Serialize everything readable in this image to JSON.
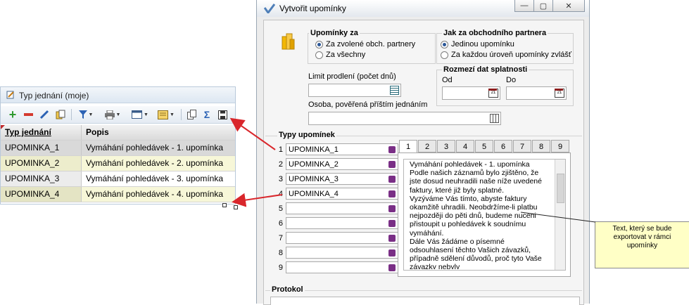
{
  "left_window": {
    "title": "Typ jednání (moje)",
    "columns": [
      "Typ jednání",
      "Popis"
    ],
    "rows": [
      {
        "code": "UPOMINKA_1",
        "desc": "Vymáhání pohledávek - 1. upomínka"
      },
      {
        "code": "UPOMINKA_2",
        "desc": "Vymáhání pohledávek - 2. upomínka"
      },
      {
        "code": "UPOMINKA_3",
        "desc": "Vymáhání pohledávek - 3. upomínka"
      },
      {
        "code": "UPOMINKA_4",
        "desc": "Vymáhání pohledávek - 4. upomínka"
      }
    ]
  },
  "dialog": {
    "title": "Vytvořit upomínky",
    "upominky_za": {
      "label": "Upomínky za",
      "options": [
        "Za zvolené obch. partnery",
        "Za všechny"
      ],
      "selected": 0
    },
    "jak_za": {
      "label": "Jak za obchodního partnera",
      "options": [
        "Jedinou upomínku",
        "Za každou úroveň upomínky zvlášť"
      ],
      "selected": 0
    },
    "limit_label": "Limit prodlení (počet dnů)",
    "rozmezi": {
      "label": "Rozmezí dat splatnosti",
      "od": "Od",
      "do": "Do"
    },
    "osoba_label": "Osoba, pověřená příštím jednáním",
    "typy_label": "Typy upomínek",
    "typy": [
      {
        "num": "1",
        "value": "UPOMINKA_1"
      },
      {
        "num": "2",
        "value": "UPOMINKA_2"
      },
      {
        "num": "3",
        "value": "UPOMINKA_3"
      },
      {
        "num": "4",
        "value": "UPOMINKA_4"
      },
      {
        "num": "5",
        "value": ""
      },
      {
        "num": "6",
        "value": ""
      },
      {
        "num": "7",
        "value": ""
      },
      {
        "num": "8",
        "value": ""
      },
      {
        "num": "9",
        "value": ""
      }
    ],
    "tabs": [
      "1",
      "2",
      "3",
      "4",
      "5",
      "6",
      "7",
      "8",
      "9"
    ],
    "active_tab": 0,
    "memo": "Vymáhání pohledávek - 1. upomínka\nPodle našich záznamů bylo zjištěno, že jste dosud neuhradili naše níže uvedené faktury, které již byly splatné.\nVyzýváme Vás tímto, abyste faktury okamžitě uhradili. Neobdržíme-li platbu nejpozději do pěti dnů, budeme nuceni přistoupit u pohledávek k soudnímu vymáhání.\nDále Vás žádáme o písemné odsouhlasení těchto Vašich závazků, případně sdělení důvodů, proč tyto Vaše závazky nebyly",
    "protokol_label": "Protokol"
  },
  "callout": "Text, který se bude exportovat v rámci upomínky",
  "colors": {
    "accent": "#2b5797",
    "arrow": "#d9262b",
    "row_alt": "#f7f7d8",
    "row_sel": "#d9d9d9"
  }
}
